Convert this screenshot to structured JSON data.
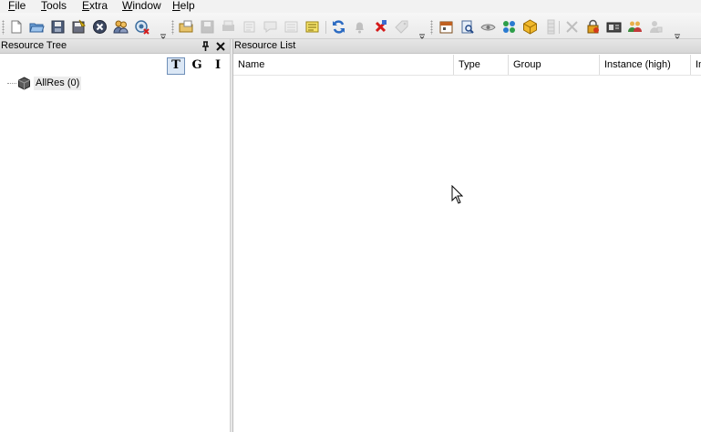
{
  "menu": {
    "file": {
      "u": "F",
      "rest": "ile"
    },
    "tools": {
      "u": "T",
      "rest": "ools"
    },
    "extra": {
      "u": "E",
      "rest": "xtra"
    },
    "window": {
      "u": "W",
      "rest": "indow"
    },
    "help": {
      "u": "H",
      "rest": "elp"
    }
  },
  "toolbar_icons": [
    "new-document-icon",
    "open-folder-icon",
    "save-icon",
    "save-all-icon",
    "stop-icon",
    "users-icon",
    "disconnect-icon",
    "open-project-icon",
    "save-disabled-icon",
    "print-disabled-icon",
    "delete-disabled-icon",
    "comment-disabled-icon",
    "list-disabled-icon",
    "note-icon",
    "refresh-icon",
    "bell-disabled-icon",
    "delete-red-icon",
    "tag-disabled-icon",
    "calendar-icon",
    "report-icon",
    "view-icon",
    "grid-icon",
    "package-icon",
    "column-disabled-icon",
    "cut-disabled-icon",
    "lock-icon",
    "card-icon",
    "user-group-icon",
    "user-disabled-icon"
  ],
  "left_panel": {
    "title": "Resource Tree",
    "mode_buttons": {
      "t": "T",
      "g": "G",
      "i": "I"
    },
    "root_node": "AllRes (0)"
  },
  "right_panel": {
    "title": "Resource List",
    "columns": [
      "Name",
      "Type",
      "Group",
      "Instance (high)",
      "In"
    ]
  },
  "colors": {
    "menubar_bg": "#f2f2f2",
    "panel_title_bg": "#dedede",
    "active_mode_bg": "#dbe7f5"
  }
}
